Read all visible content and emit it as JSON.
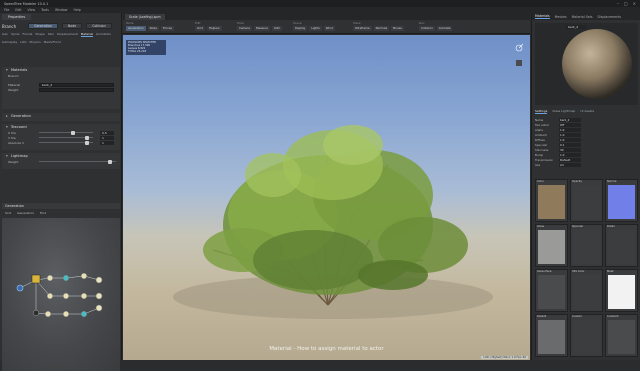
{
  "window": {
    "title": "SpeedTree Modeler 10.0.1",
    "controls": [
      "–",
      "□",
      "×"
    ]
  },
  "menubar": [
    "File",
    "Edit",
    "View",
    "Tools",
    "Window",
    "Help"
  ],
  "left_panel": {
    "tab": "Properties",
    "objects_title": "Branch",
    "objects_buttons": [
      "Generation",
      "Node",
      "Collision"
    ],
    "sub_tabs": [
      "Gen",
      "Spine",
      "Fronds",
      "Shape",
      "Skin",
      "Displacement",
      "Material",
      "Animation",
      "Gameplay",
      "LOD",
      "Physics",
      "Mesh/Frond"
    ],
    "selected_sub_tab": "Material",
    "material_section": {
      "title": "Materials",
      "group": "Branch",
      "material_label": "Material",
      "material_value": "bark_2",
      "weight_label": "Weight"
    },
    "generation_section": {
      "title": "Generation"
    },
    "texcoord_section": {
      "title": "Texcoord",
      "rows": [
        {
          "label": "U tile",
          "value": "0.5"
        },
        {
          "label": "V tile",
          "value": "1"
        },
        {
          "label": "Absolute V",
          "value": "1"
        }
      ]
    },
    "lightmap_section": {
      "title": "Lightmap",
      "weight_label": "Weight"
    },
    "graph_title": "Generation",
    "graph_toolbar": [
      "Sort",
      "Generators",
      "Find"
    ]
  },
  "viewport": {
    "tab": "Scale (Leafing).spm",
    "toolbar": {
      "groups": [
        {
          "label": "Mode",
          "items": [
            "Generation",
            "Node",
            "Forces"
          ]
        },
        {
          "label": "Edit",
          "items": [
            "Grid",
            "Helpers"
          ]
        },
        {
          "label": "Tools",
          "items": [
            "Camera",
            "Measure",
            "LOD"
          ]
        },
        {
          "label": "Scene",
          "items": [
            "Display",
            "Lights",
            "Wind"
          ]
        },
        {
          "label": "Show",
          "items": [
            "Wireframe",
            "Normals",
            "Bones"
          ]
        },
        {
          "label": "Run",
          "items": [
            "Collision",
            "Animate"
          ]
        }
      ]
    },
    "stats": [
      "POLYGONS  SELECTED",
      "Branches  17,396",
      "Leaves  6,822",
      "TOTAL  24,218"
    ],
    "caption": "Material - How to assign material to actor",
    "status": "LOD: (Highest)  Wind: 1.0  Fps: 60"
  },
  "right_panel": {
    "tabs": [
      "Materials",
      "Meshes",
      "Material Sets",
      "Displacements"
    ],
    "selected_tab": "Materials",
    "material_name": "bark_2",
    "sub_tabs": [
      "Settings",
      "Class Lightmap",
      "UI Assets"
    ],
    "props": [
      {
        "k": "Name",
        "v": "bark_2"
      },
      {
        "k": "Two sided",
        "v": "Off"
      },
      {
        "k": "Alpha",
        "v": "1.0"
      },
      {
        "k": "Ambient",
        "v": "1.0"
      },
      {
        "k": "Diffuse",
        "v": "1.0"
      },
      {
        "k": "Specular",
        "v": "0.1"
      },
      {
        "k": "Shininess",
        "v": "30"
      },
      {
        "k": "Bump",
        "v": "1.0"
      },
      {
        "k": "Transmission",
        "v": "Default"
      },
      {
        "k": "Use",
        "v": "All"
      }
    ],
    "textures": [
      {
        "label": "Color",
        "swatch": "#8f7a5c"
      },
      {
        "label": "Opacity",
        "swatch": "#3c3d3f"
      },
      {
        "label": "Normal",
        "swatch": "#7180e8"
      },
      {
        "label": "Gloss",
        "swatch": "#9a9a98"
      },
      {
        "label": "Specular",
        "swatch": "#3c3d3f"
      },
      {
        "label": "Detail",
        "swatch": "#3c3d3f"
      },
      {
        "label": "Subsurface",
        "swatch": "#4a4b4d"
      },
      {
        "label": "SSS Color",
        "swatch": "#3c3d3f"
      },
      {
        "label": "Mask",
        "swatch": "#f2f2f2"
      },
      {
        "label": "Detail2",
        "swatch": "#6a6b6d"
      },
      {
        "label": "Custom",
        "swatch": "#3c3d3f"
      },
      {
        "label": "Custom2",
        "swatch": "#4a4b4d"
      }
    ]
  }
}
